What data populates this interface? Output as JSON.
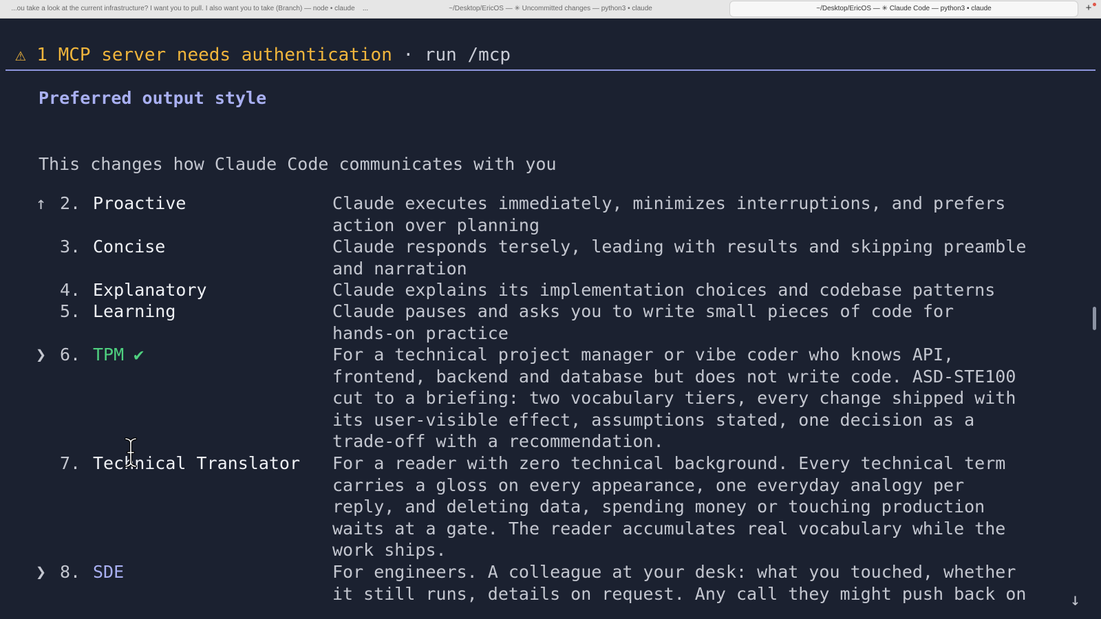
{
  "tabs": [
    {
      "label": "...ou take a look at the current infrastructure? I want you to pull. I also want you to take (Branch) — node • claude"
    },
    {
      "label": "~/Desktop/EricOS — ✳ Uncommitted changes — python3 • claude"
    },
    {
      "label": "~/Desktop/EricOS — ✳ Claude Code — python3 • claude",
      "active": true
    }
  ],
  "tab_more": "...",
  "tab_add": "+",
  "banner": {
    "warning": "⚠ 1 MCP server needs authentication",
    "separator": " · ",
    "hint": "run /mcp"
  },
  "panel": {
    "title": "Preferred output style",
    "subtitle": "This changes how Claude Code communicates with you"
  },
  "options": [
    {
      "marker": "↑",
      "number": "2.",
      "name": "Proactive",
      "desc": [
        "Claude executes immediately, minimizes interruptions, and prefers",
        "action over planning"
      ]
    },
    {
      "marker": "",
      "number": "3.",
      "name": "Concise",
      "desc": [
        "Claude responds tersely, leading with results and skipping preamble",
        "and narration"
      ]
    },
    {
      "marker": "",
      "number": "4.",
      "name": "Explanatory",
      "desc": [
        "Claude explains its implementation choices and codebase patterns"
      ]
    },
    {
      "marker": "",
      "number": "5.",
      "name": "Learning",
      "desc": [
        "Claude pauses and asks you to write small pieces of code for",
        "hands-on practice"
      ]
    },
    {
      "marker": "❯",
      "number": "6.",
      "name": "TPM",
      "check": "✔",
      "desc": [
        "For a technical project manager or vibe coder who knows API,",
        "frontend, backend and database but does not write code. ASD-STE100",
        "cut to a briefing: two vocabulary tiers, every change shipped with",
        "its user-visible effect, assumptions stated, one decision as a",
        "trade-off with a recommendation."
      ]
    },
    {
      "marker": "",
      "number": "7.",
      "name": "Technical Translator",
      "desc": [
        "For a reader with zero technical background. Every technical term",
        "carries a gloss on every appearance, one everyday analogy per",
        "reply, and deleting data, spending money or touching production",
        "waits at a gate. The reader accumulates real vocabulary while the",
        "work ships."
      ]
    },
    {
      "marker": "❯",
      "number": "8.",
      "name": "SDE",
      "desc": [
        "For engineers. A colleague at your desk: what you touched, whether",
        "it still runs, details on request. Any call they might push back on"
      ]
    }
  ],
  "scroll_down_indicator": "↓",
  "colors": {
    "background": "#1b2130",
    "warning": "#f0b53c",
    "accent": "#a9b0f2",
    "selected": "#4fd07f"
  }
}
